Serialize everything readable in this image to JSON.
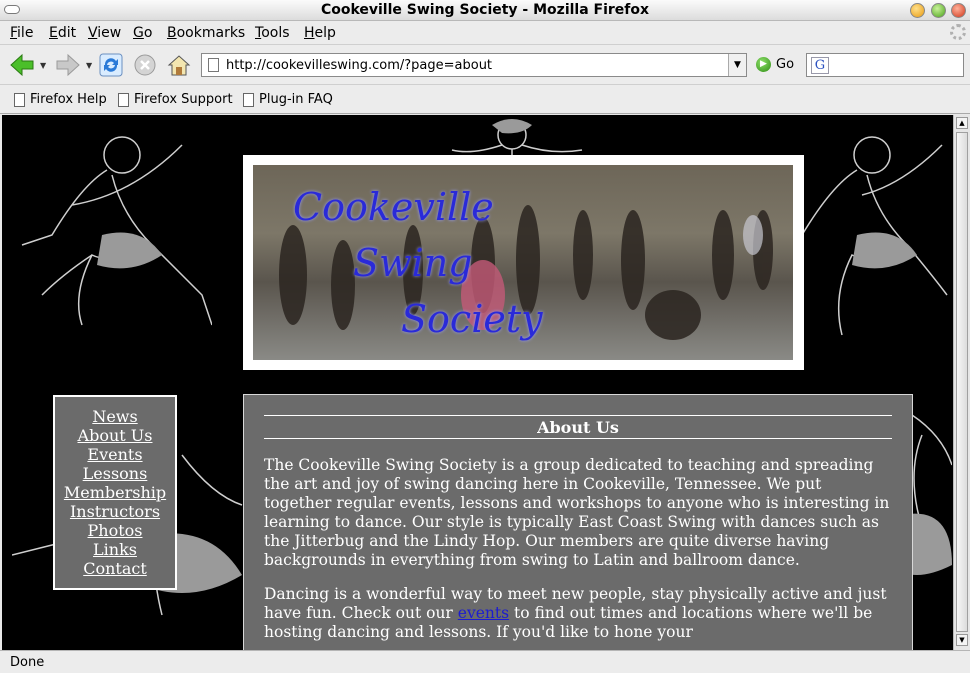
{
  "window": {
    "title": "Cookeville Swing Society - Mozilla Firefox"
  },
  "menu": [
    "File",
    "Edit",
    "View",
    "Go",
    "Bookmarks",
    "Tools",
    "Help"
  ],
  "menu_mnemonics": [
    "F",
    "E",
    "V",
    "G",
    "B",
    "T",
    "H"
  ],
  "toolbar": {
    "url": "http://cookevilleswing.com/?page=about",
    "go_label": "Go",
    "search_engine_icon": "G"
  },
  "bookmarks": [
    "Firefox Help",
    "Firefox Support",
    "Plug-in FAQ"
  ],
  "banner": {
    "title_lines": [
      "Cookeville",
      "Swing",
      "Society"
    ]
  },
  "nav": [
    "News",
    "About Us",
    "Events",
    "Lessons",
    "Membership",
    "Instructors",
    "Photos",
    "Links",
    "Contact"
  ],
  "content": {
    "heading": "About Us",
    "p1": "The Cookeville Swing Society is a group dedicated to teaching and spreading the art and joy of swing dancing here in Cookeville, Tennessee. We put together regular events, lessons and workshops to anyone who is interesting in learning to dance. Our style is typically East Coast Swing with dances such as the Jitterbug and the Lindy Hop. Our members are quite diverse having backgrounds in everything from swing to Latin and ballroom dance.",
    "p2_before": "Dancing is a wonderful way to meet new people, stay physically active and just have fun. Check out our ",
    "p2_link": "events",
    "p2_after": " to find out times and locations where we'll be hosting dancing and lessons. If you'd like to hone your"
  },
  "status": "Done",
  "colors": {
    "page_bg": "#000000",
    "panel_bg": "#6b6b6b",
    "link": "#1c1cd0",
    "banner_text": "#2a2ad8"
  }
}
